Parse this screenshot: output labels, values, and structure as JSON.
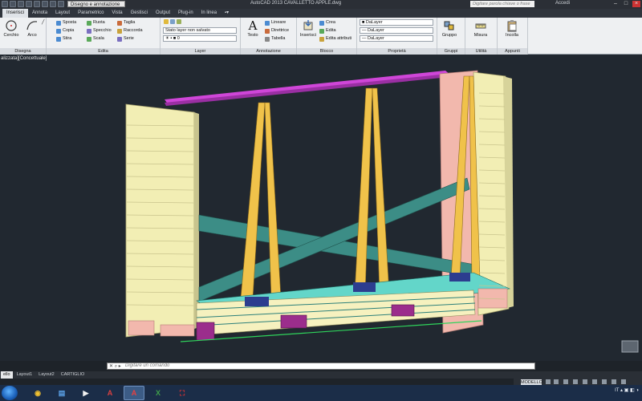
{
  "titlebar": {
    "workspace": "Disegno e annotazione",
    "title": "AutoCAD 2013   CAVALLETTO APPLE.dwg",
    "search_placeholder": "Digitare parola chiave o frase",
    "signin": "Accedi"
  },
  "tabs": [
    "Inserisci",
    "Annota",
    "Layout",
    "Parametrico",
    "Vista",
    "Gestisci",
    "Output",
    "Plug-in",
    "In linea"
  ],
  "ribbon": {
    "disegna": {
      "title": "Disegna",
      "cerchio": "Cerchio",
      "arco": "Arco"
    },
    "edita": {
      "title": "Edita",
      "sposta": "Sposta",
      "ruota": "Ruota",
      "taglia": "Taglia",
      "copia": "Copia",
      "specchio": "Specchio",
      "raccorda": "Raccorda",
      "stira": "Stira",
      "scala": "Scala",
      "serie": "Serie"
    },
    "layer": {
      "title": "Layer",
      "stato": "Stato layer non salvato",
      "current": "0"
    },
    "annotazione": {
      "title": "Annotazione",
      "testo": "Testo",
      "lineare": "Lineare",
      "direttrice": "Direttrice",
      "tabella": "Tabella"
    },
    "blocco": {
      "title": "Blocco",
      "inserisci": "Inserisci",
      "crea": "Crea",
      "edita": "Edita",
      "edita_attributi": "Edita attributi"
    },
    "proprieta": {
      "title": "Proprietà",
      "color": "DaLayer",
      "linetype": "DaLayer",
      "lineweight": "DaLayer"
    },
    "gruppi": {
      "title": "Gruppi",
      "gruppo": "Gruppo"
    },
    "utilita": {
      "title": "Utilità",
      "misura": "Misura"
    },
    "appunti": {
      "title": "Appunti",
      "incolla": "Incolla"
    }
  },
  "viewport_label": "alizzata][Concettuale]",
  "command_placeholder": "Digitare un comando",
  "layout_tabs": [
    "ello",
    "Layout1",
    "Layout2",
    "CARTIGLIO"
  ],
  "status": {
    "model": "MODELLO"
  },
  "tray": {
    "lang": "IT"
  },
  "colors": {
    "panel_yellow": "#f2eeb4",
    "upright_orange": "#f0c24a",
    "brace_teal": "#3c8d86",
    "top_bar_magenta": "#cf46d8",
    "end_pink": "#f2b8ad",
    "block_purple": "#9b2d8c",
    "pad_navy": "#2c3d8f",
    "canvas": "#212830"
  }
}
